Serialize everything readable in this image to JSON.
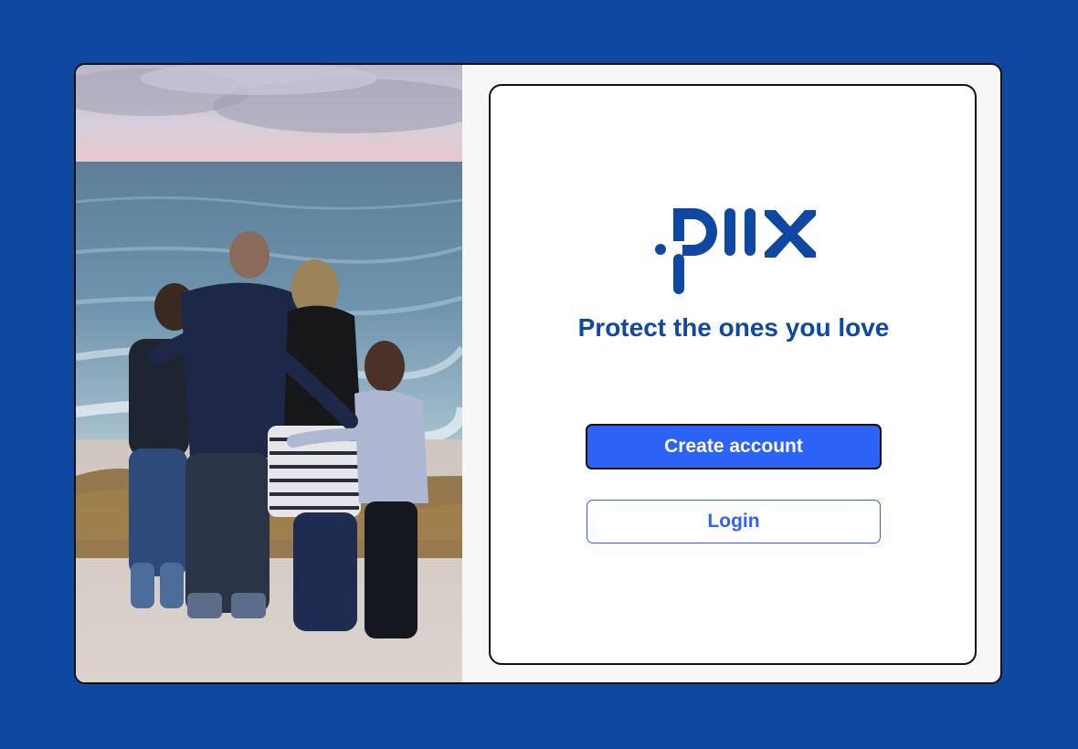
{
  "brand": {
    "logo_text": "piix",
    "colors": {
      "background": "#0f48a3",
      "primary": "#2c63f6",
      "brand_blue": "#0f48a3"
    }
  },
  "hero_image": {
    "icon": "family-beach-photo"
  },
  "welcome": {
    "tagline": "Protect the ones you love",
    "create_account_label": "Create account",
    "login_label": "Login"
  }
}
